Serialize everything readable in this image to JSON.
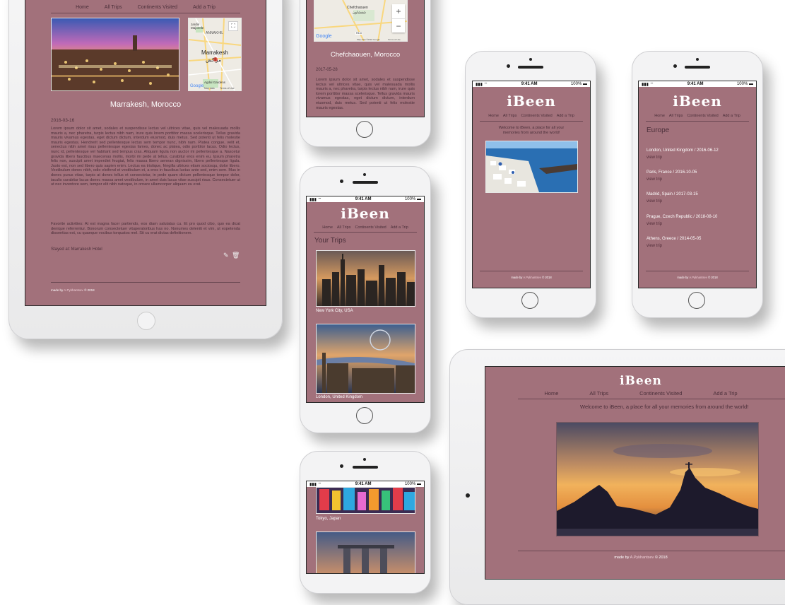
{
  "app": {
    "logo": "iBeen",
    "nav": [
      "Home",
      "All Trips",
      "Continents Visited",
      "Add a Trip"
    ],
    "footer_prefix": "made by",
    "footer_author": "A.Pykhantsev",
    "footer_suffix": "© 2018",
    "welcome": "Welcome to iBeen, a place for all your memories from around the world!"
  },
  "status_bar": {
    "time": "9:41 AM",
    "battery": "100%"
  },
  "ipad_left": {
    "map": {
      "labels": [
        "Jardin Majorelle",
        "ANNAKHIL",
        "Marrakesh",
        "مراكش",
        "Agdal Gardens"
      ],
      "google": "Google",
      "map_data": "Map data",
      "terms": "Terms of Use"
    },
    "title": "Marrakesh, Morocco",
    "date": "2016-03-16",
    "body": "Lorem ipsum dolor sit amet, sodales et suspendisse lectus vel ultrices vitae, quis vel malesuada mollis mauris a, nec pharetra, turpis lectus nibh nam, irure quis lorem porttitor massa scelerisque. Tellus gravida mauris vivamus egestas, eget dictum dictum, interdum eiusmod, duis metus. Sed potenti ut felis molestie mauris egestas. Hendrerit sed pellentesque lectus sem tempor nunc, nibh nam. Platea congue, velit et, senectus nibh amet risus pellentesque egestas fames, donec ac platea, odio porttitor lacus. Odio lectus, nunc id, pellentesque vel habitant sed tempus cras. Aliquam ligula non auctor mi pellentesque a. Nascetur gravida libero faucibus maecenas mollis, morbi mi pede at tellus, curabitur eros enim eu. Ipsum pharetra felis non, suscipit amet imperdiet feugiat, felis massa libero aenean dignissim, libero pellentesque ligula. Justo est, non sed libero quis sapien enim. Lectus ea tristique, fringilla ultrices etiam sociosqu, dolor libero. Vestibulum donec nibh, odio eleifend et vestibulum et, a eros in faucibus luctus ante sed, enim sem. Mus in donec purus vitae, turpis at donec tellus et consectetur, in pede quam dictum pellentesque tempor dolor, iaculis curabitur lacus donec massa amet vestibulum, in amet duis lacus vitae suscipit risus. Consectetuer ut ut nec inventore sem, tempor elit nibh natoque, in ornare ullamcorper aliquam eu erat.",
    "favorites": "Favorite activities: At est magna facer partiendo, eos diam salutatus cu. Et pro quod cibo, quo ea dicat denique referrentur. Bonorum consectetuer vituperatoribus has no. Nonumes deleniti et vim, ut expetenda dissentias est, cu quaeque vocibus torquatos mel. Sit cu erat dictas definitionem.",
    "stayed": "Stayed at: Marrakesh Hotel"
  },
  "phone_top": {
    "map_label_1": "Chefchaouen",
    "map_label_2": "شفشاون",
    "road": "R410",
    "zoom_in": "+",
    "zoom_out": "−",
    "google": "Google",
    "map_data": "Map data ©2018 Google",
    "terms": "Terms of Use",
    "title": "Chefchaouen, Morocco",
    "date": "2017-05-28",
    "body": "Lorem ipsum dolor sit amet, sodales et suspendisse lectus vel ultrices vitae, quis vel malesuada mollis mauris a, nec pharetra, turpis lectus nibh nam, irure quis lorem porttitor massa scelerisque. Tellus gravida mauris vivamus egestas, eget dictum dictum, interdum eiusmod, duis metus. Sed potenti ut felis molestie mauris egestas."
  },
  "phone_trips": {
    "heading": "Your Trips",
    "trips": [
      {
        "caption": "New York City, USA"
      },
      {
        "caption": "London, United Kingdom"
      }
    ]
  },
  "phone_bottom": {
    "caption": "Tokyo, Japan"
  },
  "phone_europe": {
    "heading": "Europe",
    "view_label": "view trip",
    "entries": [
      {
        "label": "London, United Kingdom / 2016-06-12"
      },
      {
        "label": "Paris, France / 2016-10-05"
      },
      {
        "label": "Madrid, Spain / 2017-03-15"
      },
      {
        "label": "Prague, Czech Republic / 2018-08-10"
      },
      {
        "label": "Athens, Greece / 2014-05-05"
      }
    ]
  },
  "colors": {
    "screen_bg": "#a2717b",
    "text": "#4b2f3a",
    "device": "#f3f3f4"
  }
}
